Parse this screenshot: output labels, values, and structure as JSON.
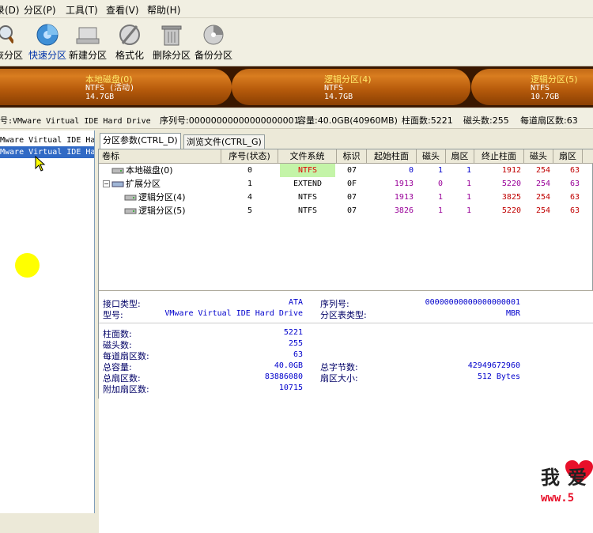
{
  "menu": [
    "录(D)",
    "分区(P)",
    "工具(T)",
    "查看(V)",
    "帮助(H)"
  ],
  "toolbar": [
    {
      "label": "恢分区",
      "icon": "magnifier-icon"
    },
    {
      "label": "快速分区",
      "icon": "quick-partition-icon"
    },
    {
      "label": "新建分区",
      "icon": "new-partition-icon"
    },
    {
      "label": "格式化",
      "icon": "format-icon"
    },
    {
      "label": "删除分区",
      "icon": "trash-icon"
    },
    {
      "label": "备份分区",
      "icon": "backup-icon"
    }
  ],
  "diskmap": [
    {
      "name": "本地磁盘(0)",
      "fs": "NTFS (活动)",
      "size": "14.7GB"
    },
    {
      "name": "逻辑分区(4)",
      "fs": "NTFS",
      "size": "14.7GB"
    },
    {
      "name": "逻辑分区(5)",
      "fs": "NTFS",
      "size": "10.7GB"
    }
  ],
  "diskinfo": {
    "model": "号:VMware Virtual IDE Hard Drive",
    "serial": "序列号:00000000000000000001",
    "capacity": "容量:40.0GB(40960MB)",
    "cylinders": "柱面数:5221",
    "heads": "磁头数:255",
    "sectors": "每道扇区数:63"
  },
  "tree": [
    {
      "label": "Mware Virtual IDE Ha"
    },
    {
      "label": "Mware Virtual IDE Ha"
    }
  ],
  "tabs": [
    "分区参数(CTRL_D)",
    "浏览文件(CTRL_G)"
  ],
  "table": {
    "headers": [
      "卷标",
      "序号(状态)",
      "文件系统",
      "标识",
      "起始柱面",
      "磁头",
      "扇区",
      "终止柱面",
      "磁头",
      "扇区"
    ],
    "rows": [
      {
        "name": "本地磁盘(0)",
        "seq": "0",
        "fs": "NTFS",
        "id": "07",
        "sc": "0",
        "sh": "1",
        "ss": "1",
        "ec": "1912",
        "eh": "254",
        "es": "63"
      },
      {
        "name": "扩展分区",
        "seq": "1",
        "fs": "EXTEND",
        "id": "0F",
        "sc": "1913",
        "sh": "0",
        "ss": "1",
        "ec": "5220",
        "eh": "254",
        "es": "63"
      },
      {
        "name": "逻辑分区(4)",
        "seq": "4",
        "fs": "NTFS",
        "id": "07",
        "sc": "1913",
        "sh": "1",
        "ss": "1",
        "ec": "3825",
        "eh": "254",
        "es": "63"
      },
      {
        "name": "逻辑分区(5)",
        "seq": "5",
        "fs": "NTFS",
        "id": "07",
        "sc": "3826",
        "sh": "1",
        "ss": "1",
        "ec": "5220",
        "eh": "254",
        "es": "63"
      }
    ]
  },
  "details": {
    "iface_label": "接口类型:",
    "iface_value": "ATA",
    "model_label": "型号:",
    "model_value": "VMware Virtual IDE Hard Drive",
    "serial_label": "序列号:",
    "serial_value": "00000000000000000001",
    "pttype_label": "分区表类型:",
    "pttype_value": "MBR",
    "cyl_label": "柱面数:",
    "cyl_value": "5221",
    "heads_label": "磁头数:",
    "heads_value": "255",
    "spt_label": "每道扇区数:",
    "spt_value": "63",
    "cap_label": "总容量:",
    "cap_value": "40.0GB",
    "bytes_label": "总字节数:",
    "bytes_value": "42949672960",
    "tsec_label": "总扇区数:",
    "tsec_value": "83886080",
    "ssize_label": "扇区大小:",
    "ssize_value": "512 Bytes",
    "extra_label": "附加扇区数:",
    "extra_value": "10715"
  },
  "watermark": {
    "line1": "我爱",
    "line2": "www.5"
  }
}
